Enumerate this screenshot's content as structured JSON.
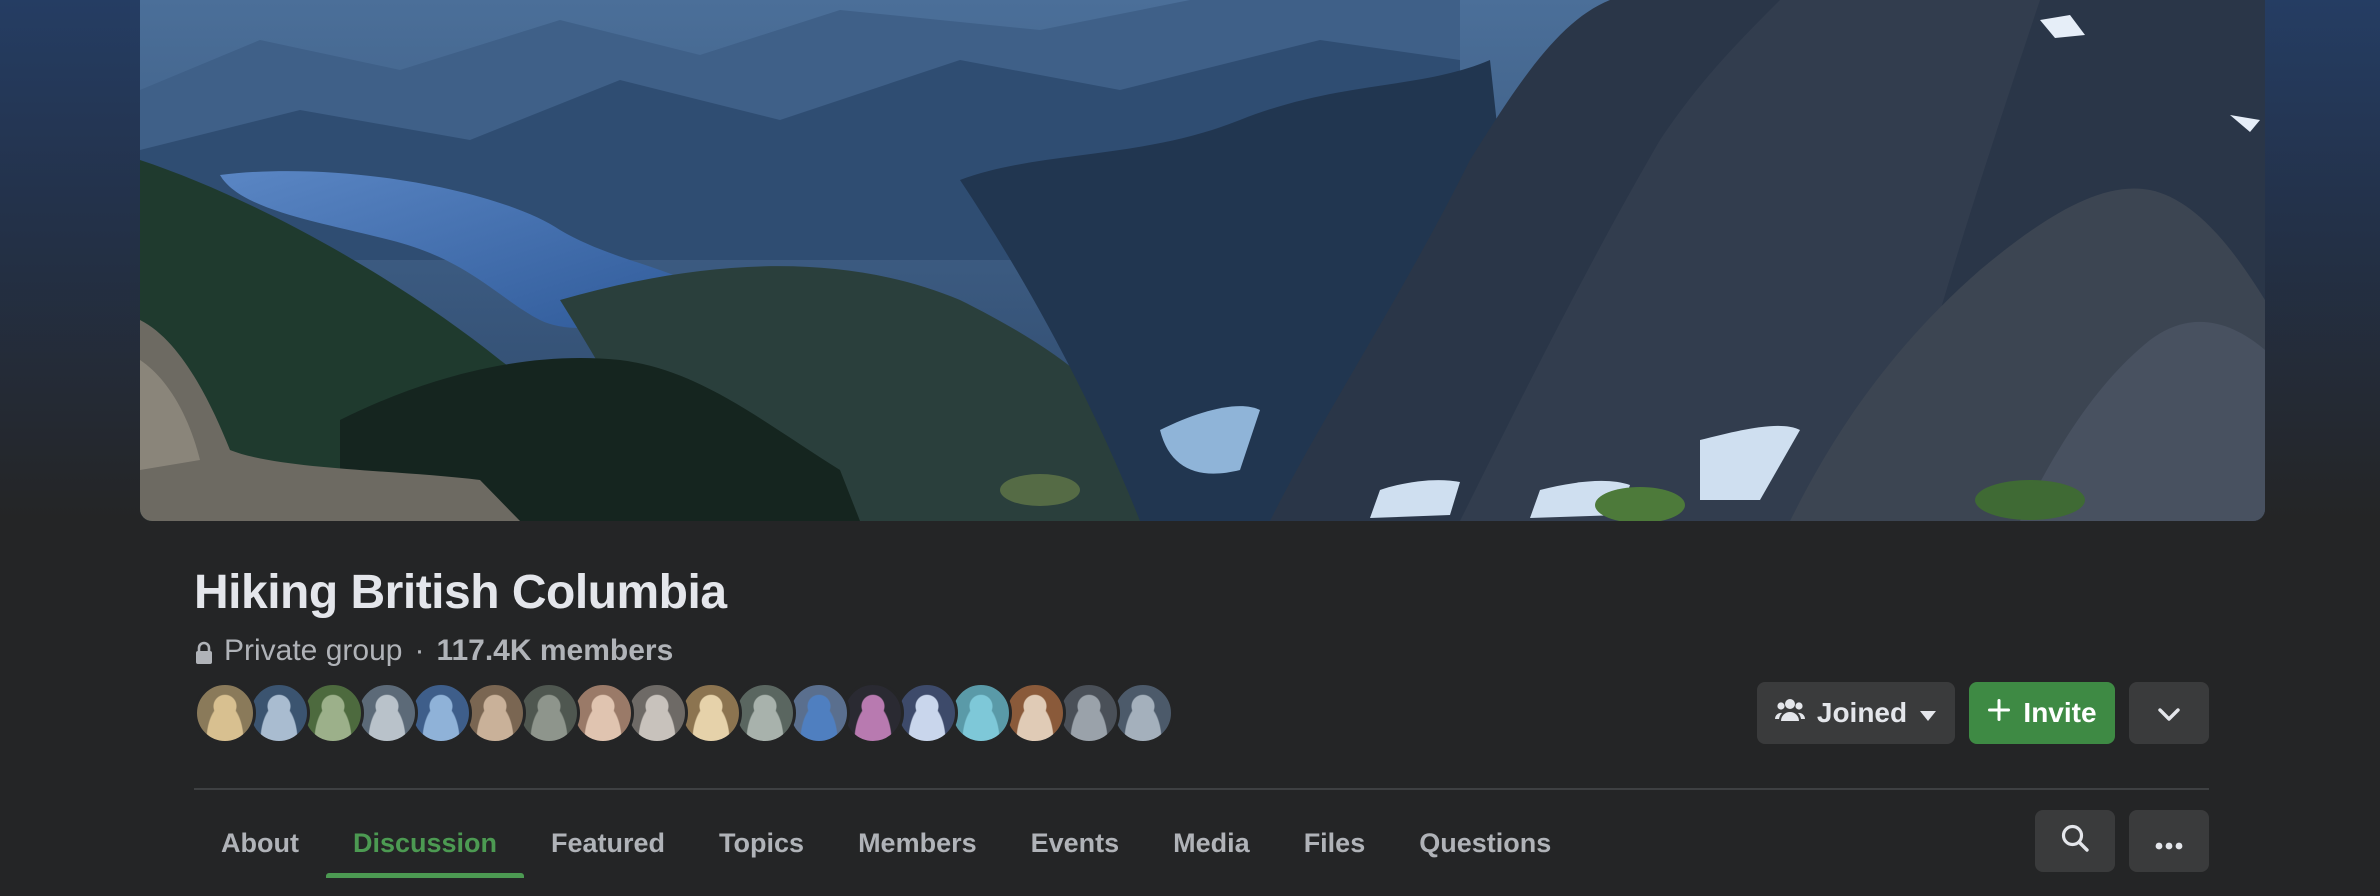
{
  "group": {
    "name": "Hiking British Columbia",
    "privacy": "Private group",
    "separator": "·",
    "members": "117.4K members"
  },
  "member_avatars": [
    {
      "color": "#8a7a5a",
      "accent": "#d8c090"
    },
    {
      "color": "#3b5470",
      "accent": "#a9bcd0"
    },
    {
      "color": "#4d6a3e",
      "accent": "#9cb08a"
    },
    {
      "color": "#5c6a78",
      "accent": "#b9c2ca"
    },
    {
      "color": "#3e5e8a",
      "accent": "#8fb2d8"
    },
    {
      "color": "#7a6652",
      "accent": "#c9b199"
    },
    {
      "color": "#4f5750",
      "accent": "#8e958c"
    },
    {
      "color": "#9a7a68",
      "accent": "#e0c4b0"
    },
    {
      "color": "#6e6a66",
      "accent": "#c8c2bc"
    },
    {
      "color": "#8c7450",
      "accent": "#e6d2aa"
    },
    {
      "color": "#5a6660",
      "accent": "#a8b2ac"
    },
    {
      "color": "#5a6f8e",
      "accent": "#4f7fc0"
    },
    {
      "color": "#2a2a32",
      "accent": "#b87ab0"
    },
    {
      "color": "#3d4a6a",
      "accent": "#c9d6ec"
    },
    {
      "color": "#5a9aa8",
      "accent": "#7ec8d8"
    },
    {
      "color": "#8a5a3a",
      "accent": "#e0cbb6"
    },
    {
      "color": "#4a5058",
      "accent": "#9aa2aa"
    },
    {
      "color": "#4c5a6a",
      "accent": "#a4b0bc"
    }
  ],
  "actions": {
    "joined_label": "Joined",
    "invite_label": "Invite"
  },
  "tabs": [
    {
      "label": "About"
    },
    {
      "label": "Discussion",
      "active": true
    },
    {
      "label": "Featured"
    },
    {
      "label": "Topics"
    },
    {
      "label": "Members"
    },
    {
      "label": "Events"
    },
    {
      "label": "Media"
    },
    {
      "label": "Files"
    },
    {
      "label": "Questions"
    }
  ],
  "icons": {
    "privacy": "lock-icon",
    "joined": "people-icon",
    "joined_caret": "caret-down-icon",
    "invite": "plus-icon",
    "expand": "chevron-down-icon",
    "search": "search-icon",
    "more": "more-dots-icon"
  },
  "colors": {
    "accent_green": "#4c9a52",
    "invite_green": "#3e8a44",
    "page_bg": "#242526",
    "button_bg": "#3a3b3c"
  }
}
